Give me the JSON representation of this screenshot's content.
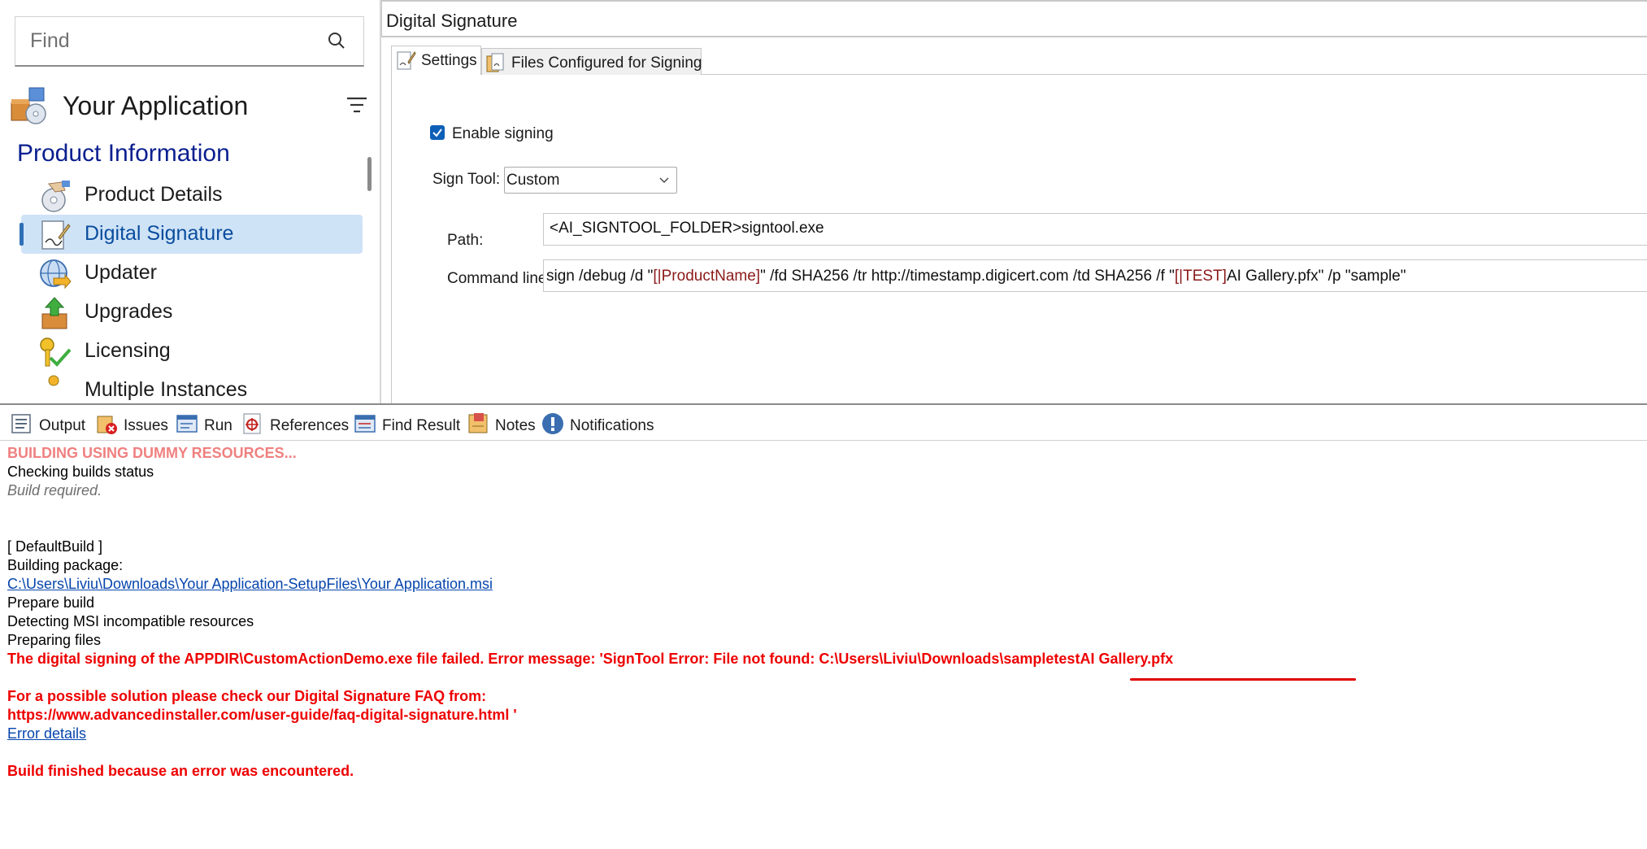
{
  "search": {
    "placeholder": "Find"
  },
  "app": {
    "title": "Your Application"
  },
  "sidebar": {
    "section_title": "Product Information",
    "items": [
      {
        "label": "Product Details"
      },
      {
        "label": "Digital Signature"
      },
      {
        "label": "Updater"
      },
      {
        "label": "Upgrades"
      },
      {
        "label": "Licensing"
      },
      {
        "label": "Multiple Instances"
      }
    ]
  },
  "panel": {
    "title": "Digital Signature",
    "tabs": [
      {
        "label": "Settings"
      },
      {
        "label": "Files Configured for Signing"
      }
    ],
    "enable_signing_label": "Enable signing",
    "enable_signing_checked": true,
    "sign_tool_label": "Sign Tool:",
    "sign_tool_value": "Custom",
    "path_label": "Path:",
    "path_value": "<AI_SIGNTOOL_FOLDER>signtool.exe",
    "command_label": "Command line:",
    "command_parts": [
      "sign /debug /d \"",
      "[|ProductName]",
      "\" /fd SHA256 /tr http://timestamp.digicert.com /td SHA256 /f \"",
      "[|TEST]",
      "AI Gallery.pfx\" /p \"sample\""
    ]
  },
  "bottom_tabs": [
    {
      "label": "Output"
    },
    {
      "label": "Issues"
    },
    {
      "label": "Run"
    },
    {
      "label": "References"
    },
    {
      "label": "Find Result"
    },
    {
      "label": "Notes"
    },
    {
      "label": "Notifications"
    }
  ],
  "output": {
    "building_dummy": "BUILDING USING DUMMY RESOURCES...",
    "checking_status": "Checking builds status",
    "build_required": "Build required.",
    "default_build": "[ DefaultBuild ]",
    "building_package": "Building package:",
    "msi_path": "C:\\Users\\Liviu\\Downloads\\Your Application-SetupFiles\\Your Application.msi",
    "prepare_build": "Prepare build",
    "detecting_msi": "Detecting MSI incompatible resources",
    "preparing_files": "Preparing files",
    "sign_error": "The digital signing of the APPDIR\\CustomActionDemo.exe file failed. Error message: 'SignTool Error: File not found: C:\\Users\\Liviu\\Downloads\\sampletestAI Gallery.pfx",
    "faq_line1": "For a possible solution please check our Digital Signature FAQ from:",
    "faq_line2": "https://www.advancedinstaller.com/user-guide/faq-digital-signature.html  '",
    "error_details": "Error details",
    "build_finished": "Build finished because an error was encountered."
  },
  "colors": {
    "accent": "#0e5fb8",
    "selected_bg": "#cfe3f7",
    "section_title": "#0a1f8f",
    "error_red": "#ee0000",
    "warning_pink": "#f08080",
    "link_blue": "#0645ad"
  },
  "icons": {
    "search": "search-icon",
    "filter": "filter-icon",
    "app": "app-package-icon",
    "product_details": "cd-hand-icon",
    "digital_signature": "signature-pen-icon",
    "updater": "globe-arrow-icon",
    "upgrades": "box-up-arrow-icon",
    "licensing": "key-check-icon"
  }
}
